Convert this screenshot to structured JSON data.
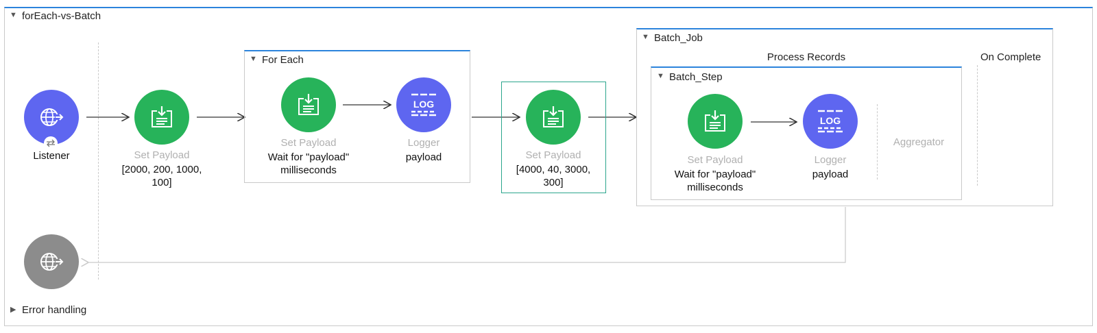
{
  "flow": {
    "title": "forEach-vs-Batch",
    "error_handling_label": "Error handling"
  },
  "listener": {
    "label": "Listener",
    "icon": "globe-arrow-icon"
  },
  "set_payload_1": {
    "title": "Set Payload",
    "value": "[2000, 200, 1000, 100]"
  },
  "for_each": {
    "title": "For Each",
    "set_payload": {
      "title": "Set Payload",
      "value": "Wait for \"payload\" milliseconds"
    },
    "logger": {
      "title": "Logger",
      "value": "payload",
      "icon_text": "LOG"
    }
  },
  "set_payload_2": {
    "title": "Set Payload",
    "value": "[4000, 40, 3000, 300]"
  },
  "batch_job": {
    "title": "Batch_Job",
    "process_records_label": "Process Records",
    "on_complete_label": "On Complete",
    "batch_step": {
      "title": "Batch_Step",
      "set_payload": {
        "title": "Set Payload",
        "value": "Wait for \"payload\" milliseconds"
      },
      "logger": {
        "title": "Logger",
        "value": "payload",
        "icon_text": "LOG"
      },
      "aggregator_label": "Aggregator"
    }
  },
  "colors": {
    "accent": "#2b83dc",
    "processor_green": "#27b35a",
    "logger_blue": "#5e66f0",
    "listener_blue": "#5e66f0",
    "response_gray": "#8c8c8c",
    "selection": "#2aa58c"
  }
}
